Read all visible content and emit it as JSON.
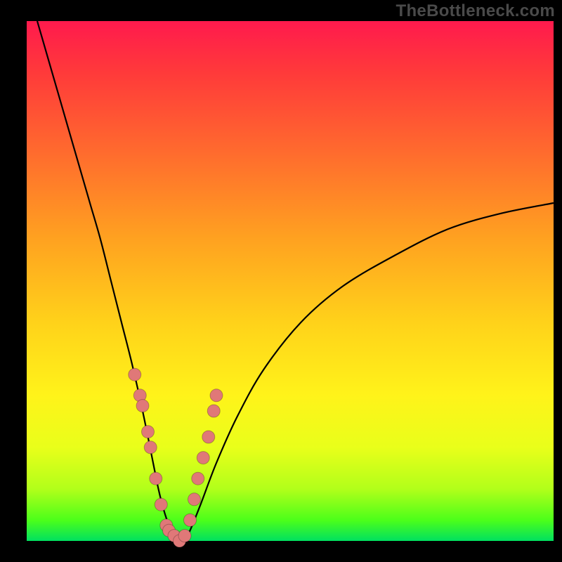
{
  "watermark": "TheBottleneck.com",
  "colors": {
    "gradient_top": "#ff1a4d",
    "gradient_bottom": "#00e060",
    "curve": "#000000",
    "dots": "#e07878",
    "background": "#000000"
  },
  "chart_data": {
    "type": "line",
    "title": "",
    "xlabel": "",
    "ylabel": "",
    "xlim": [
      0,
      100
    ],
    "ylim": [
      0,
      100
    ],
    "grid": false,
    "legend": false,
    "series": [
      {
        "name": "bottleneck-curve",
        "x": [
          2,
          4,
          6,
          8,
          10,
          12,
          14,
          16,
          18,
          20,
          22,
          24,
          25,
          26,
          27,
          28,
          29,
          30,
          31,
          33,
          36,
          40,
          45,
          52,
          60,
          70,
          80,
          90,
          100
        ],
        "y": [
          100,
          93,
          86,
          79,
          72,
          65,
          58,
          50,
          42,
          34,
          25,
          15,
          10,
          6,
          3,
          1,
          0,
          0,
          2,
          7,
          15,
          24,
          33,
          42,
          49,
          55,
          60,
          63,
          65
        ]
      }
    ],
    "scatter": {
      "name": "highlighted-points",
      "x": [
        20.5,
        21.5,
        22.0,
        23.0,
        23.5,
        24.5,
        25.5,
        26.5,
        27.0,
        28.0,
        29.0,
        30.0,
        31.0,
        31.8,
        32.5,
        33.5,
        34.5,
        35.5,
        36.0
      ],
      "y": [
        32,
        28,
        26,
        21,
        18,
        12,
        7,
        3,
        2,
        1,
        0,
        1,
        4,
        8,
        12,
        16,
        20,
        25,
        28
      ]
    }
  }
}
